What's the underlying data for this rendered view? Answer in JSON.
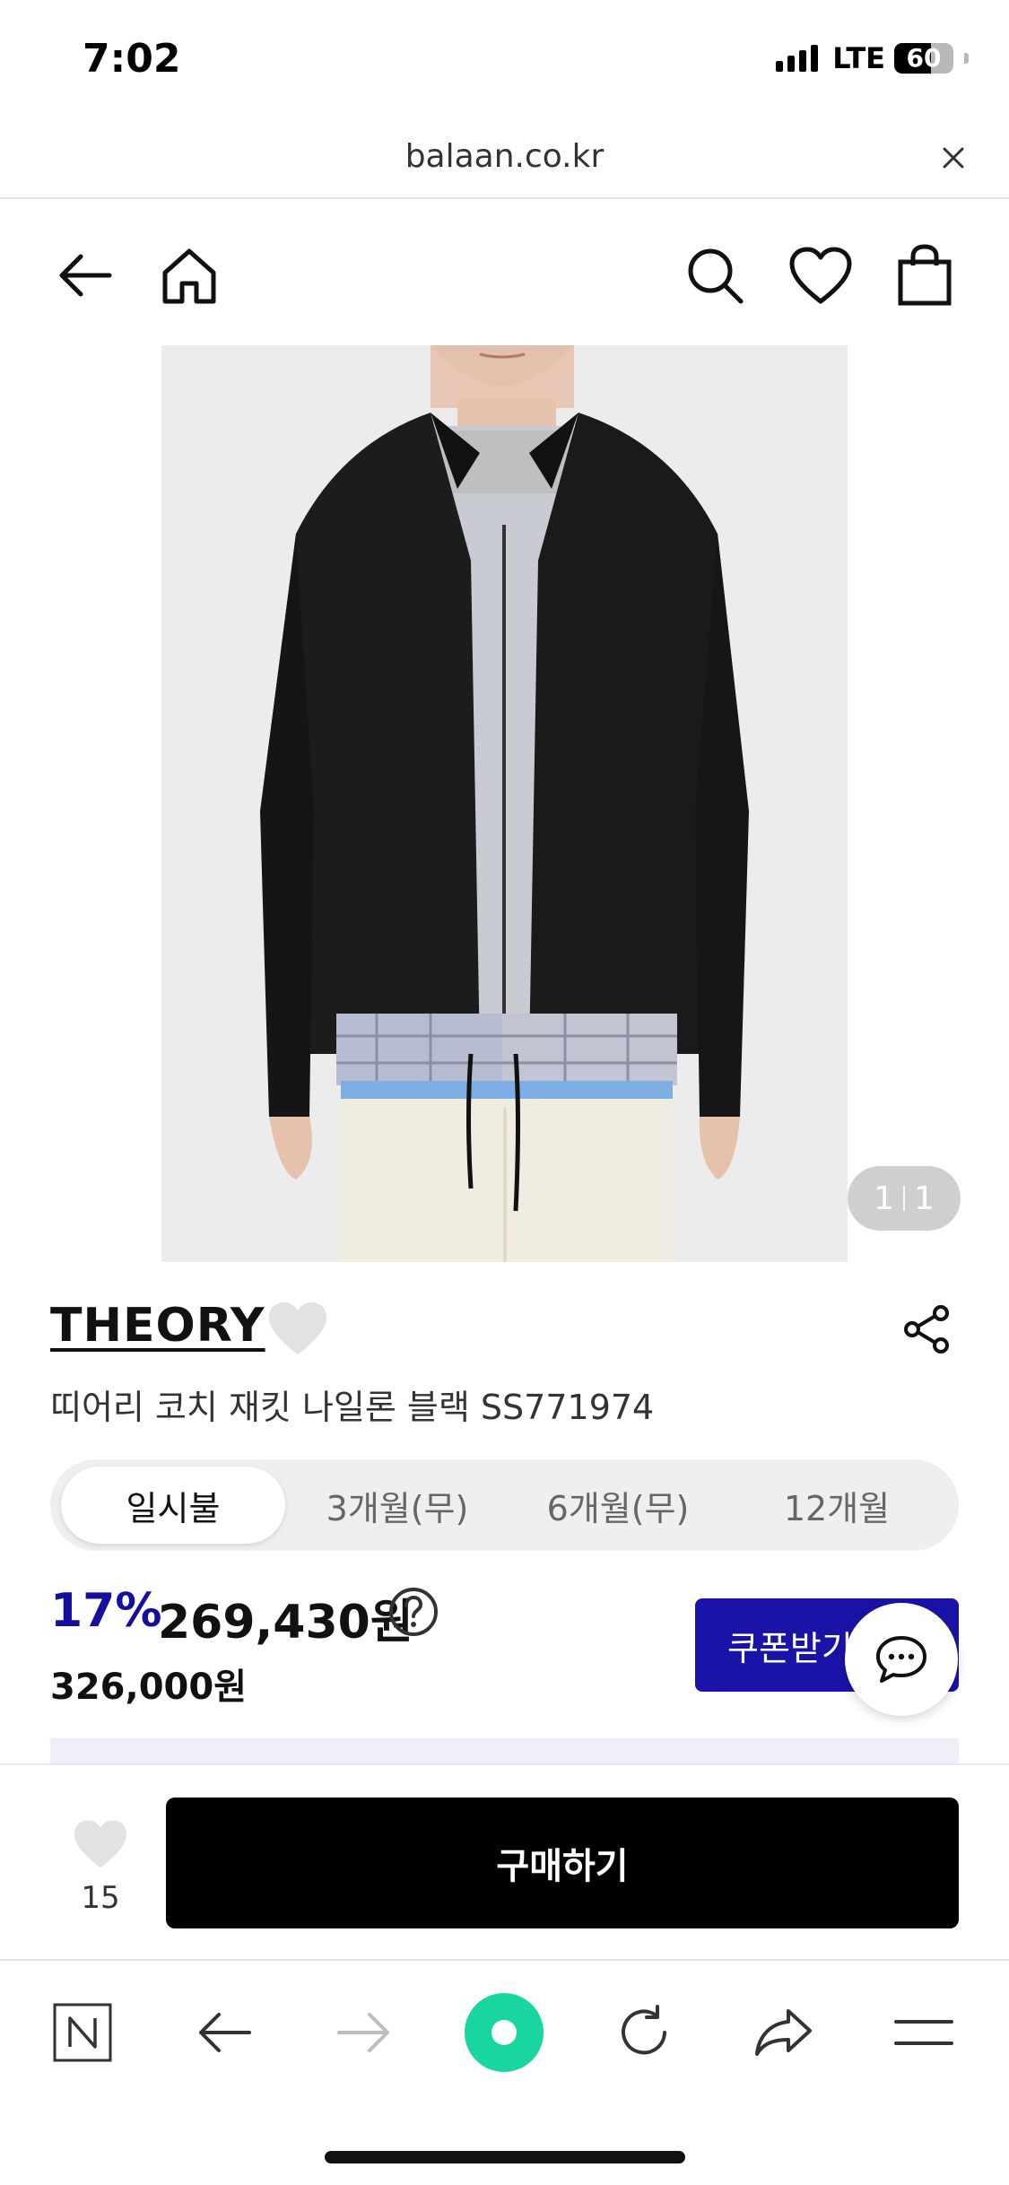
{
  "status_bar": {
    "time": "7:02",
    "network": "LTE",
    "battery": "60",
    "battery_level_percent": 60
  },
  "url_bar": {
    "url": "balaan.co.kr",
    "close_icon": "close-icon"
  },
  "header": {
    "icons": [
      "back-arrow-icon",
      "home-icon",
      "search-icon",
      "heart-icon",
      "shopping-bag-icon"
    ]
  },
  "product": {
    "image_counter_current": "1",
    "image_counter_total": "1",
    "brand": "THEORY",
    "title": "띠어리 코치 재킷 나일론 블랙 SS771974"
  },
  "installment": {
    "tabs": [
      "일시불",
      "3개월(무)",
      "6개월(무)",
      "12개월"
    ],
    "active_index": 0
  },
  "price": {
    "discount": "17%",
    "sale_price": "269,430원",
    "original_price": "326,000원",
    "coupon_label": "쿠폰받기"
  },
  "purchase_bar": {
    "like_count": "15",
    "buy_label": "구매하기"
  },
  "browser_toolbar": {
    "icons": [
      "naver-n-icon",
      "back-arrow-icon",
      "forward-arrow-icon",
      "green-dot-icon",
      "reload-icon",
      "share-icon",
      "menu-icon"
    ]
  },
  "colors": {
    "accent": "#1a13a8",
    "discount": "#150fa0",
    "buy_button": "#000000",
    "toolbar_green": "#19d6a0"
  }
}
